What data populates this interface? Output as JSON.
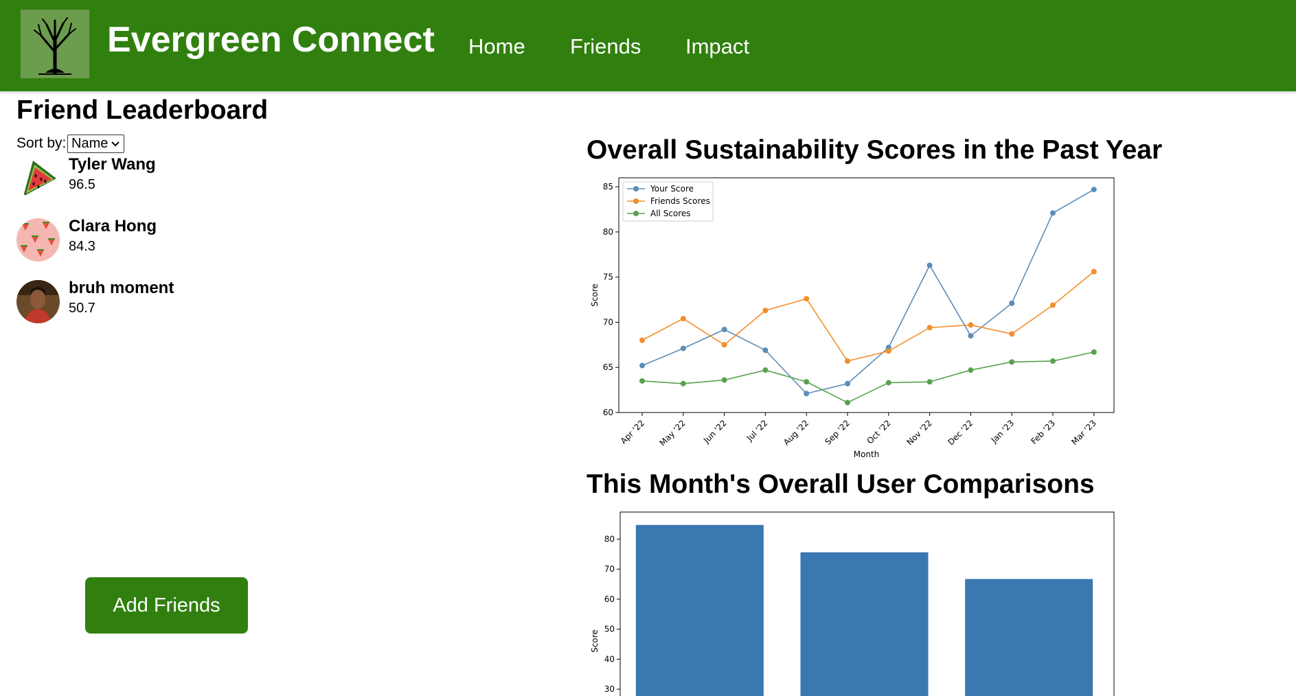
{
  "app": {
    "brand": "Evergreen Connect",
    "nav": [
      "Home",
      "Friends",
      "Impact"
    ],
    "colors": {
      "header": "#31800f",
      "logo_bg": "#6c9c4e",
      "button": "#31800f"
    }
  },
  "leaderboard": {
    "title": "Friend Leaderboard",
    "sort_label": "Sort by:",
    "sort_value": "Name",
    "friends": [
      {
        "name": "Tyler Wang",
        "score": "96.5",
        "avatar": "watermelon-slice"
      },
      {
        "name": "Clara Hong",
        "score": "84.3",
        "avatar": "watermelon-pattern"
      },
      {
        "name": "bruh moment",
        "score": "50.7",
        "avatar": "person-photo"
      }
    ],
    "add_button": "Add Friends"
  },
  "charts": {
    "line_title": "Overall Sustainability Scores in the Past Year",
    "bar_title": "This Month's Overall User Comparisons"
  },
  "chart_data": [
    {
      "type": "line",
      "title": "Overall Sustainability Scores in the Past Year",
      "xlabel": "Month",
      "ylabel": "Score",
      "categories": [
        "Apr '22",
        "May '22",
        "Jun '22",
        "Jul '22",
        "Aug '22",
        "Sep '22",
        "Oct '22",
        "Nov '22",
        "Dec '22",
        "Jan '23",
        "Feb '23",
        "Mar '23"
      ],
      "ylim": [
        60,
        86
      ],
      "yticks": [
        60,
        65,
        70,
        75,
        80,
        85
      ],
      "legend": "top-left",
      "series": [
        {
          "name": "Your Score",
          "color": "#5b8db8",
          "values": [
            65.2,
            67.1,
            69.2,
            66.9,
            62.1,
            63.2,
            67.2,
            76.3,
            68.5,
            72.1,
            82.1,
            84.7
          ]
        },
        {
          "name": "Friends Scores",
          "color": "#f28e2b",
          "values": [
            68.0,
            70.4,
            67.5,
            71.3,
            72.6,
            65.7,
            66.8,
            69.4,
            69.7,
            68.7,
            71.9,
            75.6
          ]
        },
        {
          "name": "All Scores",
          "color": "#59a14f",
          "values": [
            63.5,
            63.2,
            63.6,
            64.7,
            63.4,
            61.1,
            63.3,
            63.4,
            64.7,
            65.6,
            65.7,
            66.7
          ]
        }
      ]
    },
    {
      "type": "bar",
      "title": "This Month's Overall User Comparisons",
      "ylabel": "Score",
      "ylim": [
        25,
        89
      ],
      "yticks": [
        30,
        40,
        50,
        60,
        70,
        80
      ],
      "color": "#3b77b0",
      "values": [
        84.7,
        75.6,
        66.7
      ]
    }
  ]
}
